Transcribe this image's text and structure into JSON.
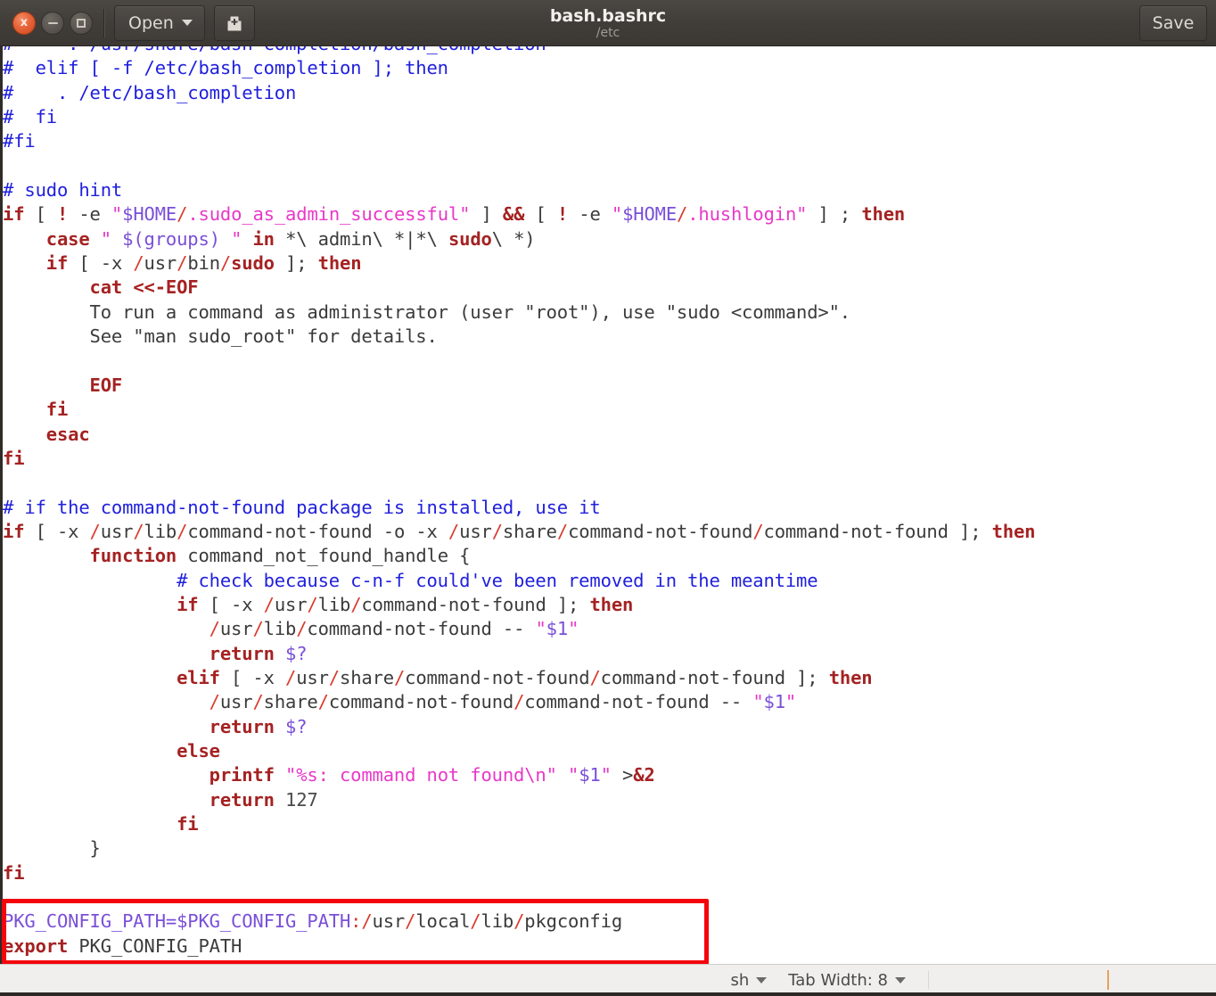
{
  "window": {
    "title": "bash.bashrc",
    "subtitle": "/etc",
    "controls": {
      "close_label": "x",
      "minimize_label": "",
      "maximize_label": ""
    },
    "toolbar": {
      "open_label": "Open",
      "new_doc_icon": "new-document-icon",
      "save_label": "Save"
    }
  },
  "statusbar": {
    "language": "sh",
    "tab_width": "Tab Width: 8"
  },
  "annotation": {
    "color": "#f4050b",
    "shape": "rectangle",
    "highlights_lines": [
      "PKG_CONFIG_PATH=$PKG_CONFIG_PATH:/usr/local/lib/pkgconfig",
      "export PKG_CONFIG_PATH"
    ]
  },
  "editor": {
    "language": "sh",
    "colors": {
      "comment": "#2020dd",
      "keyword": "#a52222",
      "string": "#e838c8",
      "variable": "#7a4fd8",
      "punctuation": "#d83b2f",
      "plain": "#2f2f2f",
      "background": "#ffffff"
    },
    "lines": [
      "#     . /usr/share/bash-completion/bash_completion",
      "#  elif [ -f /etc/bash_completion ]; then",
      "#    . /etc/bash_completion",
      "#  fi",
      "#fi",
      "",
      "# sudo hint",
      "if [ ! -e \"$HOME/.sudo_as_admin_successful\" ] && [ ! -e \"$HOME/.hushlogin\" ] ; then",
      "    case \" $(groups) \" in *\\ admin\\ *|*\\ sudo\\ *)",
      "    if [ -x /usr/bin/sudo ]; then",
      "        cat <<-EOF",
      "        To run a command as administrator (user \"root\"), use \"sudo <command>\".",
      "        See \"man sudo_root\" for details.",
      "",
      "        EOF",
      "    fi",
      "    esac",
      "fi",
      "",
      "# if the command-not-found package is installed, use it",
      "if [ -x /usr/lib/command-not-found -o -x /usr/share/command-not-found/command-not-found ]; then",
      "        function command_not_found_handle {",
      "                # check because c-n-f could've been removed in the meantime",
      "                if [ -x /usr/lib/command-not-found ]; then",
      "                   /usr/lib/command-not-found -- \"$1\"",
      "                   return $?",
      "                elif [ -x /usr/share/command-not-found/command-not-found ]; then",
      "                   /usr/share/command-not-found/command-not-found -- \"$1\"",
      "                   return $?",
      "                else",
      "                   printf \"%s: command not found\\n\" \"$1\" >&2",
      "                   return 127",
      "                fi",
      "        }",
      "fi",
      "",
      "PKG_CONFIG_PATH=$PKG_CONFIG_PATH:/usr/local/lib/pkgconfig",
      "export PKG_CONFIG_PATH"
    ],
    "lines_html": [
      "<span class=\"cm\">#     . /usr/share/bash-completion/bash_completion</span>",
      "<span class=\"cm\">#  elif [ -f /etc/bash_completion ]; then</span>",
      "<span class=\"cm\">#    . /etc/bash_completion</span>",
      "<span class=\"cm\">#  fi</span>",
      "<span class=\"cm\">#fi</span>",
      "",
      "<span class=\"cm\"># sudo hint</span>",
      "<span class=\"kw\">if</span><span class=\"pl\"> [ </span><span class=\"kw\">!</span><span class=\"pl\"> -e </span><span class=\"st\">\"</span><span class=\"vr\">$HOME</span><span class=\"sl\">/</span><span class=\"st\">.sudo_as_admin_successful\"</span><span class=\"pl\"> ] </span><span class=\"kw\">&amp;&amp;</span><span class=\"pl\"> [ </span><span class=\"kw\">!</span><span class=\"pl\"> -e </span><span class=\"st\">\"</span><span class=\"vr\">$HOME</span><span class=\"sl\">/</span><span class=\"st\">.hushlogin\"</span><span class=\"pl\"> ] ; </span><span class=\"kw\">then</span>",
      "<span class=\"pl\">    </span><span class=\"kw\">case</span><span class=\"pl\"> </span><span class=\"st\">\" </span><span class=\"vr\">$(groups)</span><span class=\"st\"> \"</span><span class=\"pl\"> </span><span class=\"kw\">in</span><span class=\"pl\"> *\\ admin\\ *|*\\ </span><span class=\"kw\">sudo</span><span class=\"pl\">\\ *)</span>",
      "<span class=\"pl\">    </span><span class=\"kw\">if</span><span class=\"pl\"> [ -x </span><span class=\"sl\">/</span><span class=\"pl\">usr</span><span class=\"sl\">/</span><span class=\"pl\">bin</span><span class=\"sl\">/</span><span class=\"kw\">sudo</span><span class=\"pl\"> ]; </span><span class=\"kw\">then</span>",
      "<span class=\"pl\">        </span><span class=\"kw\">cat &lt;&lt;-EOF</span>",
      "<span class=\"pl\">        To run a command as administrator (user \"root\"), use \"sudo &lt;command&gt;\".</span>",
      "<span class=\"pl\">        See \"man sudo_root\" for details.</span>",
      "",
      "<span class=\"pl\">        </span><span class=\"kw\">EOF</span>",
      "<span class=\"pl\">    </span><span class=\"kw\">fi</span>",
      "<span class=\"pl\">    </span><span class=\"kw\">esac</span>",
      "<span class=\"kw\">fi</span>",
      "",
      "<span class=\"cm\"># if the command-not-found package is installed, use it</span>",
      "<span class=\"kw\">if</span><span class=\"pl\"> [ -x </span><span class=\"sl\">/</span><span class=\"pl\">usr</span><span class=\"sl\">/</span><span class=\"pl\">lib</span><span class=\"sl\">/</span><span class=\"pl\">command-not-found -o -x </span><span class=\"sl\">/</span><span class=\"pl\">usr</span><span class=\"sl\">/</span><span class=\"pl\">share</span><span class=\"sl\">/</span><span class=\"pl\">command-not-found</span><span class=\"sl\">/</span><span class=\"pl\">command-not-found ]; </span><span class=\"kw\">then</span>",
      "<span class=\"pl\">        </span><span class=\"kw\">function</span><span class=\"pl\"> command_not_found_handle {</span>",
      "<span class=\"pl\">                </span><span class=\"cm\"># check because c-n-f could've been removed in the meantime</span>",
      "<span class=\"pl\">                </span><span class=\"kw\">if</span><span class=\"pl\"> [ -x </span><span class=\"sl\">/</span><span class=\"pl\">usr</span><span class=\"sl\">/</span><span class=\"pl\">lib</span><span class=\"sl\">/</span><span class=\"pl\">command-not-found ]; </span><span class=\"kw\">then</span>",
      "<span class=\"pl\">                   </span><span class=\"sl\">/</span><span class=\"pl\">usr</span><span class=\"sl\">/</span><span class=\"pl\">lib</span><span class=\"sl\">/</span><span class=\"pl\">command-not-found -- </span><span class=\"st\">\"</span><span class=\"vr\">$1</span><span class=\"st\">\"</span>",
      "<span class=\"pl\">                   </span><span class=\"kw\">return</span><span class=\"pl\"> </span><span class=\"vr\">$?</span>",
      "<span class=\"pl\">                </span><span class=\"kw\">elif</span><span class=\"pl\"> [ -x </span><span class=\"sl\">/</span><span class=\"pl\">usr</span><span class=\"sl\">/</span><span class=\"pl\">share</span><span class=\"sl\">/</span><span class=\"pl\">command-not-found</span><span class=\"sl\">/</span><span class=\"pl\">command-not-found ]; </span><span class=\"kw\">then</span>",
      "<span class=\"pl\">                   </span><span class=\"sl\">/</span><span class=\"pl\">usr</span><span class=\"sl\">/</span><span class=\"pl\">share</span><span class=\"sl\">/</span><span class=\"pl\">command-not-found</span><span class=\"sl\">/</span><span class=\"pl\">command-not-found -- </span><span class=\"st\">\"</span><span class=\"vr\">$1</span><span class=\"st\">\"</span>",
      "<span class=\"pl\">                   </span><span class=\"kw\">return</span><span class=\"pl\"> </span><span class=\"vr\">$?</span>",
      "<span class=\"pl\">                </span><span class=\"kw\">else</span>",
      "<span class=\"pl\">                   </span><span class=\"kw\">printf</span><span class=\"pl\"> </span><span class=\"st\">\"%s: command not found\\n\"</span><span class=\"pl\"> </span><span class=\"st\">\"</span><span class=\"vr\">$1</span><span class=\"st\">\"</span><span class=\"pl\"> &gt;</span><span class=\"kw\">&amp;2</span>",
      "<span class=\"pl\">                   </span><span class=\"kw\">return</span><span class=\"pl\"> </span><span class=\"nm\">127</span>",
      "<span class=\"pl\">                </span><span class=\"kw\">fi</span>",
      "<span class=\"pl\">        }</span>",
      "<span class=\"kw\">fi</span>",
      "",
      "<span class=\"vr\">PKG_CONFIG_PATH=$PKG_CONFIG_PATH</span><span class=\"sl\">:/</span><span class=\"pl\">usr</span><span class=\"sl\">/</span><span class=\"pl\">local</span><span class=\"sl\">/</span><span class=\"pl\">lib</span><span class=\"sl\">/</span><span class=\"pl\">pkgconfig</span>",
      "<span class=\"kw\">export</span><span class=\"pl\"> PKG_CONFIG_PATH</span>"
    ]
  }
}
